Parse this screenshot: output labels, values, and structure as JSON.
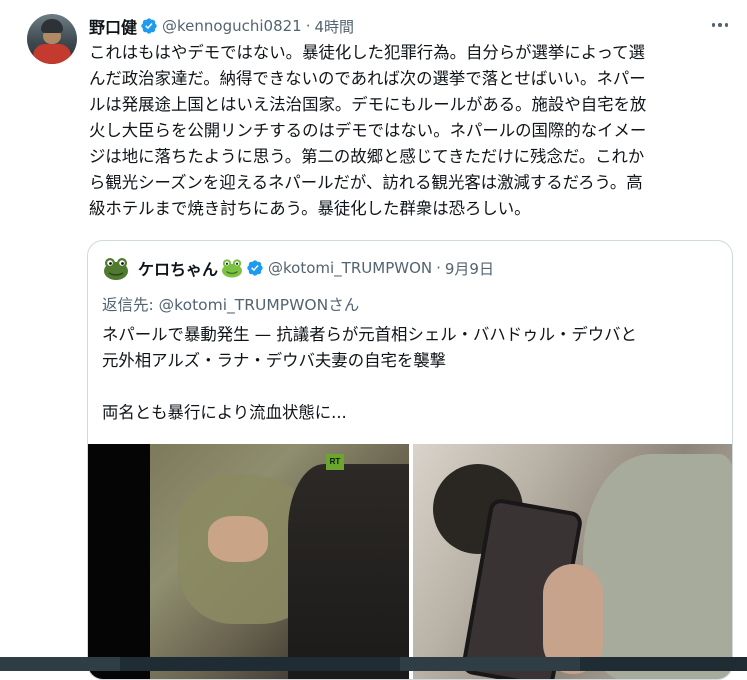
{
  "tweet": {
    "author": {
      "display_name": "野口健",
      "handle": "@kennoguchi0821",
      "time": "4時間",
      "verified": true
    },
    "body_lines": [
      "これはもはやデモではない。暴徒化した犯罪行為。自分らが選挙によって選",
      "んだ政治家達だ。納得できないのであれば次の選挙で落とせばいい。ネパー",
      "ルは発展途上国とはいえ法治国家。デモにもルールがある。施設や自宅を放",
      "火し大臣らを公開リンチするのはデモではない。ネパールの国際的なイメー",
      "ジは地に落ちたように思う。第二の故郷と感じてきただけに残念だ。これか",
      "ら観光シーズンを迎えるネパールだが、訪れる観光客は激減するだろう。高",
      "級ホテルまで焼き討ちにあう。暴徒化した群衆は恐ろしい。"
    ]
  },
  "quote": {
    "author": {
      "display_name": "ケロちゃん",
      "handle": "@kotomi_TRUMPWON",
      "date": "9月9日",
      "verified": true
    },
    "reply_prefix": "返信先: ",
    "reply_handle": "@kotomi_TRUMPWON",
    "reply_suffix": "さん",
    "text_lines": [
      "ネパールで暴動発生 — 抗議者らが元首相シェル・バハドゥル・デウバと",
      "元外相アルズ・ラナ・デウバ夫妻の自宅を襲撃",
      "",
      "両名とも暴行により流血状態に..."
    ],
    "media_logo": "RT"
  },
  "icons": {
    "verified": "verified-badge-icon",
    "more": "more-options-icon",
    "frog": "frog-emoji-icon"
  },
  "colors": {
    "verified_blue": "#1d9bf0",
    "text_primary": "#0f1419",
    "text_secondary": "#536471",
    "border": "#cfd9de"
  }
}
